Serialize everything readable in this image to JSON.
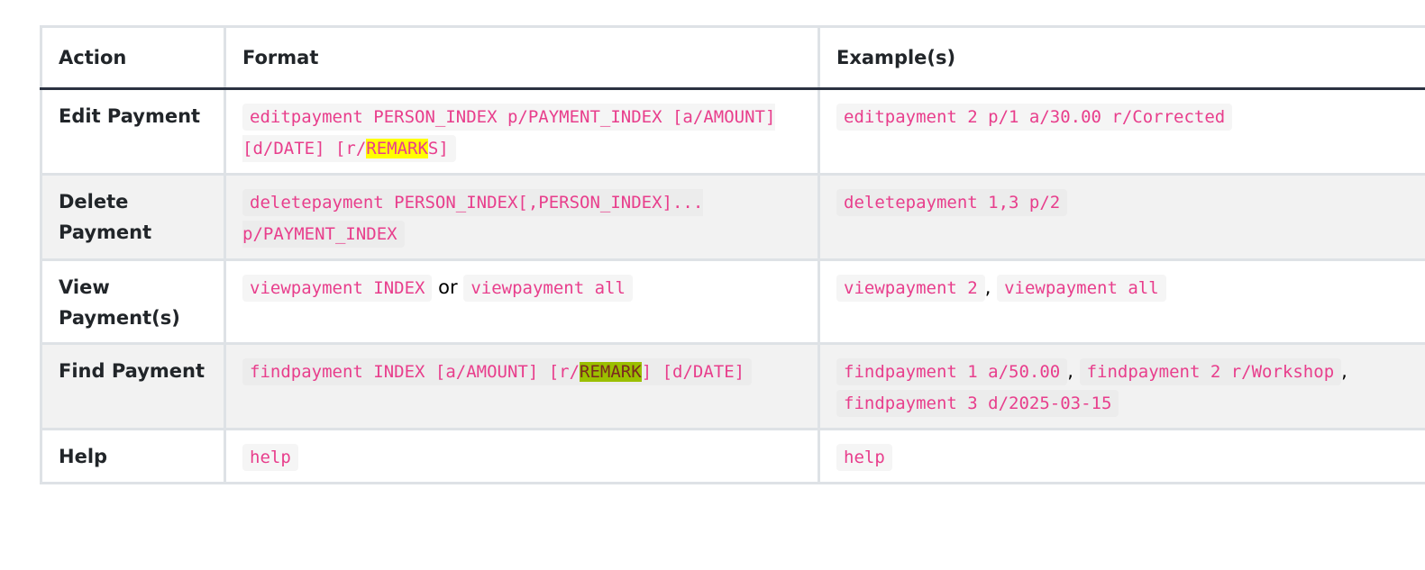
{
  "headers": {
    "action": "Action",
    "format": "Format",
    "examples": "Example(s)"
  },
  "rows": [
    {
      "action": "Edit Payment",
      "format": {
        "pre": "editpayment PERSON_INDEX p/PAYMENT_INDEX [a/AMOUNT] [d/DATE] [r/",
        "highlight": "REMARK",
        "post": "S]"
      },
      "examples": [
        "editpayment 2 p/1 a/30.00 r/Corrected"
      ]
    },
    {
      "action": "Delete Payment",
      "format": {
        "text": "deletepayment PERSON_INDEX[,PERSON_INDEX]... p/PAYMENT_INDEX"
      },
      "examples": [
        "deletepayment 1,3 p/2"
      ]
    },
    {
      "action": "View Payment(s)",
      "format": {
        "part1": "viewpayment INDEX",
        "connector": "or",
        "part2": "viewpayment all"
      },
      "examples": [
        "viewpayment 2",
        "viewpayment all"
      ],
      "example_separator": ","
    },
    {
      "action": "Find Payment",
      "format": {
        "pre": "findpayment INDEX [a/AMOUNT] [r/",
        "highlight": "REMARK",
        "post": "] [d/DATE]"
      },
      "examples": [
        "findpayment 1 a/50.00",
        "findpayment 2 r/Workshop",
        "findpayment 3 d/2025-03-15"
      ],
      "example_separator": ","
    },
    {
      "action": "Help",
      "format": {
        "text": "help"
      },
      "examples": [
        "help"
      ]
    }
  ],
  "colors": {
    "code_text": "#e83e8c",
    "highlight_yellow": "#ffff00",
    "highlight_green": "#9bbf00",
    "border": "#dee2e6",
    "header_rule": "#2b3241",
    "stripe": "#f2f2f2"
  }
}
